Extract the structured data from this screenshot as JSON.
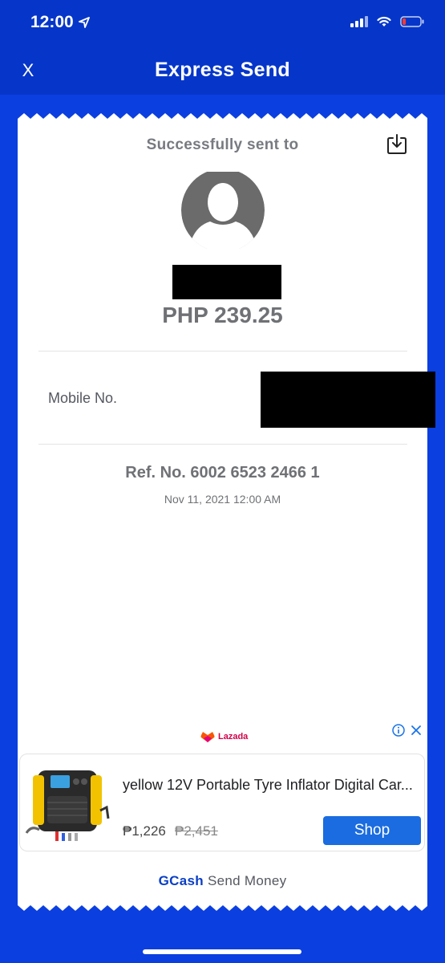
{
  "status_bar": {
    "time": "12:00",
    "icons": [
      "location-arrow-icon",
      "signal-icon",
      "wifi-icon",
      "battery-icon"
    ]
  },
  "header": {
    "close_label": "X",
    "title": "Express Send"
  },
  "receipt": {
    "success_label": "Successfully sent to",
    "amount": "PHP 239.25",
    "mobile_label": "Mobile No.",
    "reference": "Ref. No. 6002 6523 2466 1",
    "datetime": "Nov 11, 2021 12:00 AM"
  },
  "ad": {
    "brand": "Lazada",
    "title": "yellow 12V Portable Tyre Inflator Digital Car...",
    "price": "₱1,226",
    "old_price": "₱2,451",
    "shop_label": "Shop",
    "info_icon": "info-icon",
    "close_icon": "close-icon"
  },
  "footer": {
    "brand": "GCash",
    "text": "Send Money"
  },
  "colors": {
    "background": "#0b3fe0",
    "header": "#0536c9",
    "shop_button": "#1a6ce0",
    "brand_text": "#0a3ec6"
  }
}
